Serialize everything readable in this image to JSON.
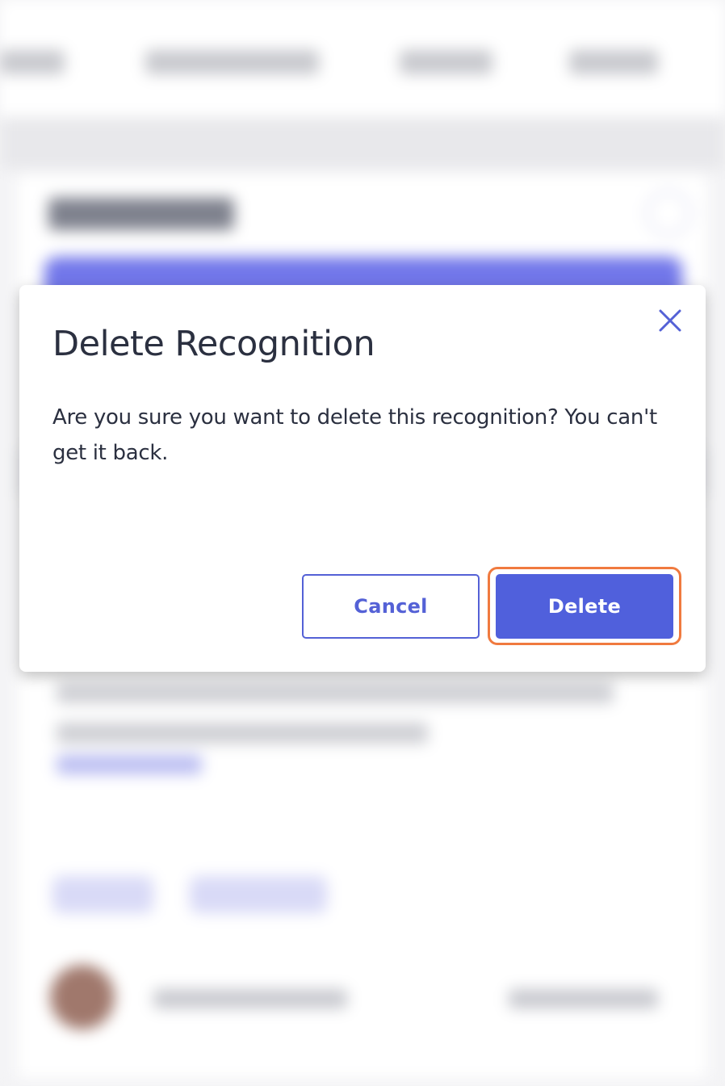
{
  "dialog": {
    "title": "Delete Recognition",
    "message": "Are you sure you want to delete this recognition? You can't get it back.",
    "cancel_label": "Cancel",
    "delete_label": "Delete",
    "close_icon": "close-icon"
  },
  "colors": {
    "accent": "#5461d6",
    "primary_button": "#5060dc",
    "focus_ring": "#f07a3f",
    "text": "#2b3040"
  }
}
